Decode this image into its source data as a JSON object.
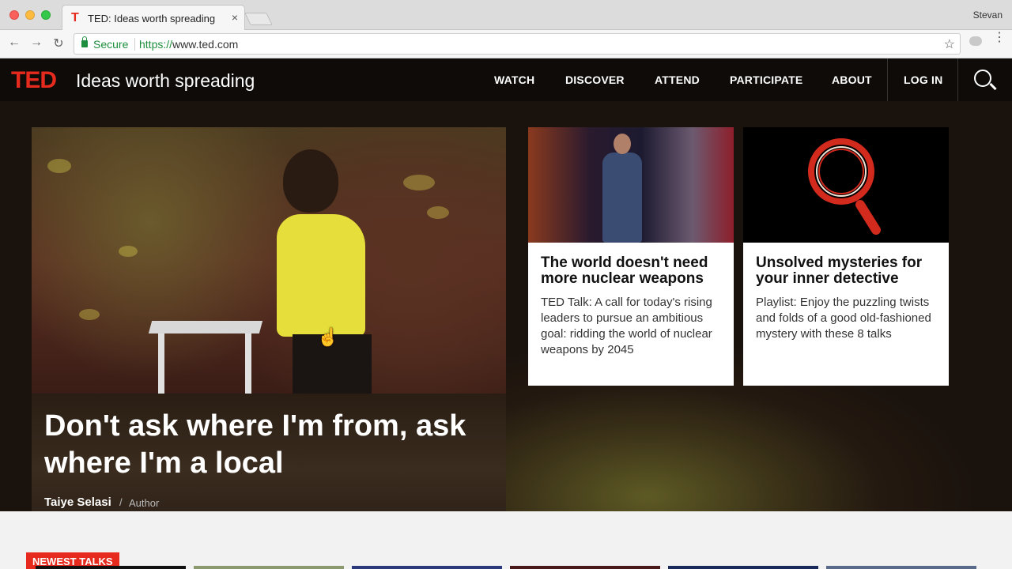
{
  "browser": {
    "tab_title": "TED: Ideas worth spreading",
    "tab_favicon": "T",
    "tab_close": "×",
    "profile_name": "Stevan",
    "secure_label": "Secure",
    "url_protocol": "https://",
    "url_host": "www.ted.com",
    "back_icon": "←",
    "forward_icon": "→",
    "reload_icon": "↻",
    "star_icon": "☆",
    "menu_icon": "⋮"
  },
  "site": {
    "logo": "TED",
    "tagline": "Ideas worth spreading",
    "nav": [
      "WATCH",
      "DISCOVER",
      "ATTEND",
      "PARTICIPATE",
      "ABOUT"
    ],
    "login": "LOG IN",
    "brand_color": "#e62b1e"
  },
  "feature": {
    "title": "Don't ask where I'm from, ask where I'm a local",
    "author": "Taiye Selasi",
    "separator": "/",
    "role": "Author"
  },
  "cards": [
    {
      "title": "The world doesn't need more nuclear weapons",
      "description": "TED Talk: A call for today's rising leaders to pursue an ambitious goal: ridding the world of nuclear weapons by 2045"
    },
    {
      "title": "Unsolved mysteries for your inner detective",
      "description": "Playlist: Enjoy the puzzling twists and folds of a good old-fashioned mystery with these 8 talks"
    }
  ],
  "newest": {
    "label": "NEWEST TALKS"
  }
}
